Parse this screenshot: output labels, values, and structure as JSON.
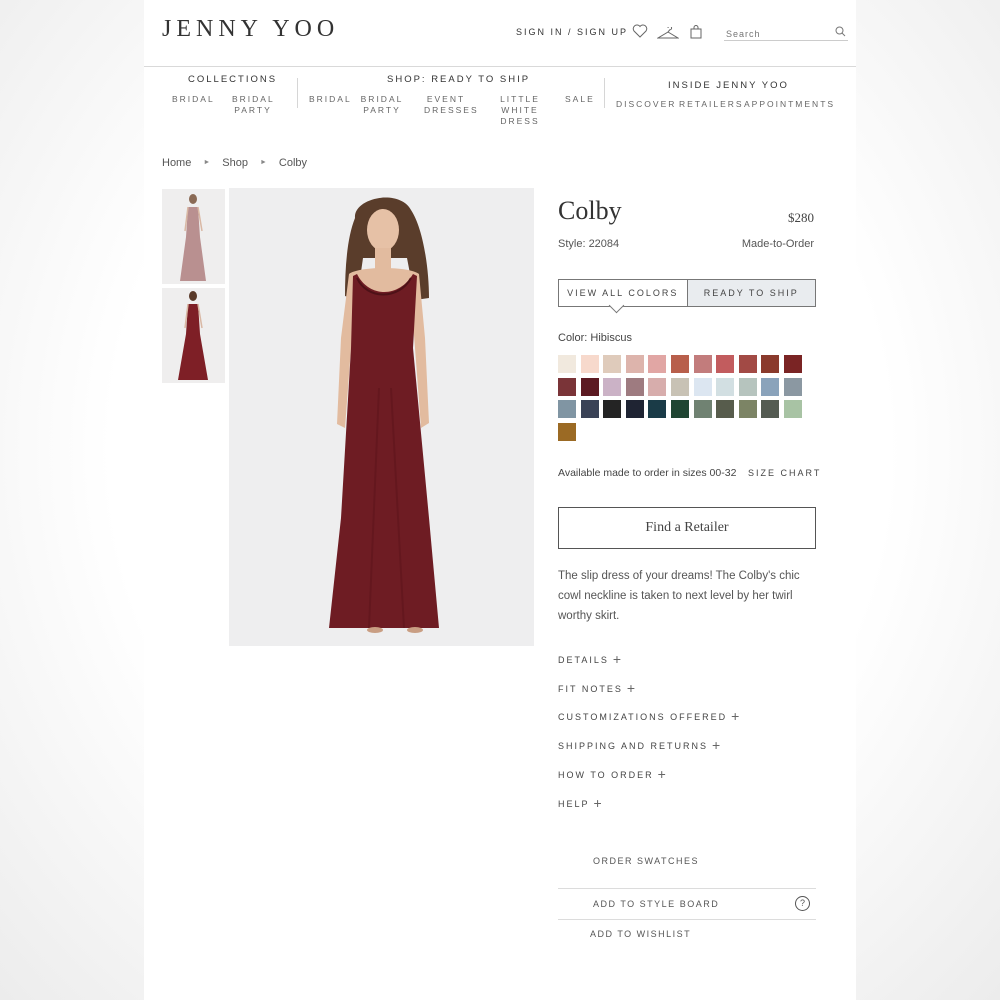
{
  "header": {
    "logo": "JENNY YOO",
    "signin": "SIGN IN / SIGN UP",
    "icons": [
      "heart-icon",
      "hanger-icon",
      "bag-icon"
    ],
    "search_placeholder": "Search"
  },
  "nav": {
    "collections": {
      "title": "COLLECTIONS",
      "items": [
        "BRIDAL",
        "BRIDAL PARTY"
      ]
    },
    "ready": {
      "title": "SHOP: READY TO SHIP",
      "items": [
        "BRIDAL",
        "BRIDAL PARTY",
        "EVENT DRESSES",
        "LITTLE WHITE DRESS",
        "SALE"
      ]
    },
    "inside": {
      "title": "INSIDE JENNY YOO",
      "items": [
        "DISCOVER",
        "RETAILERS",
        "APPOINTMENTS"
      ]
    }
  },
  "breadcrumb": [
    "Home",
    "Shop",
    "Colby"
  ],
  "product": {
    "title": "Colby",
    "price": "$280",
    "style": "Style: 22084",
    "availability": "Made-to-Order",
    "tabs": [
      "VIEW ALL COLORS",
      "READY TO SHIP"
    ],
    "color_label": "Color: Hibiscus",
    "swatch_colors": [
      "#f1e9de",
      "#f7d9cc",
      "#dfcbbb",
      "#ddb4ac",
      "#e1a6a4",
      "#b85f4b",
      "#c27c7c",
      "#c25c5e",
      "#a24a45",
      "#8a3a2c",
      "#7a2424",
      "#7a3438",
      "#5c1a22",
      "#cbb2c6",
      "#9e7b80",
      "#d7adac",
      "#c8c2b5",
      "#dce6f1",
      "#d2dfe2",
      "#b6c4be",
      "#8aa3bb",
      "#8b98a2",
      "#8095a3",
      "#3a4256",
      "#242424",
      "#1f2433",
      "#1a3b47",
      "#1f4532",
      "#708272",
      "#575c4c",
      "#7c8465",
      "#545b52",
      "#a8c3a4",
      "#9b6a24"
    ],
    "sizes_text": "Available made to order in sizes 00-32",
    "size_chart": "SIZE CHART",
    "retailer_btn": "Find a Retailer",
    "description": "The slip dress of your dreams! The Colby's chic cowl neckline is taken to next level by her twirl worthy skirt.",
    "accordions": [
      "DETAILS",
      "FIT NOTES",
      "CUSTOMIZATIONS OFFERED",
      "SHIPPING AND RETURNS",
      "HOW TO ORDER",
      "HELP"
    ],
    "actions": {
      "swatches": "ORDER SWATCHES",
      "styleboard": "ADD TO STYLE BOARD",
      "wishlist": "ADD TO WISHLIST",
      "help_icon": "?"
    }
  }
}
